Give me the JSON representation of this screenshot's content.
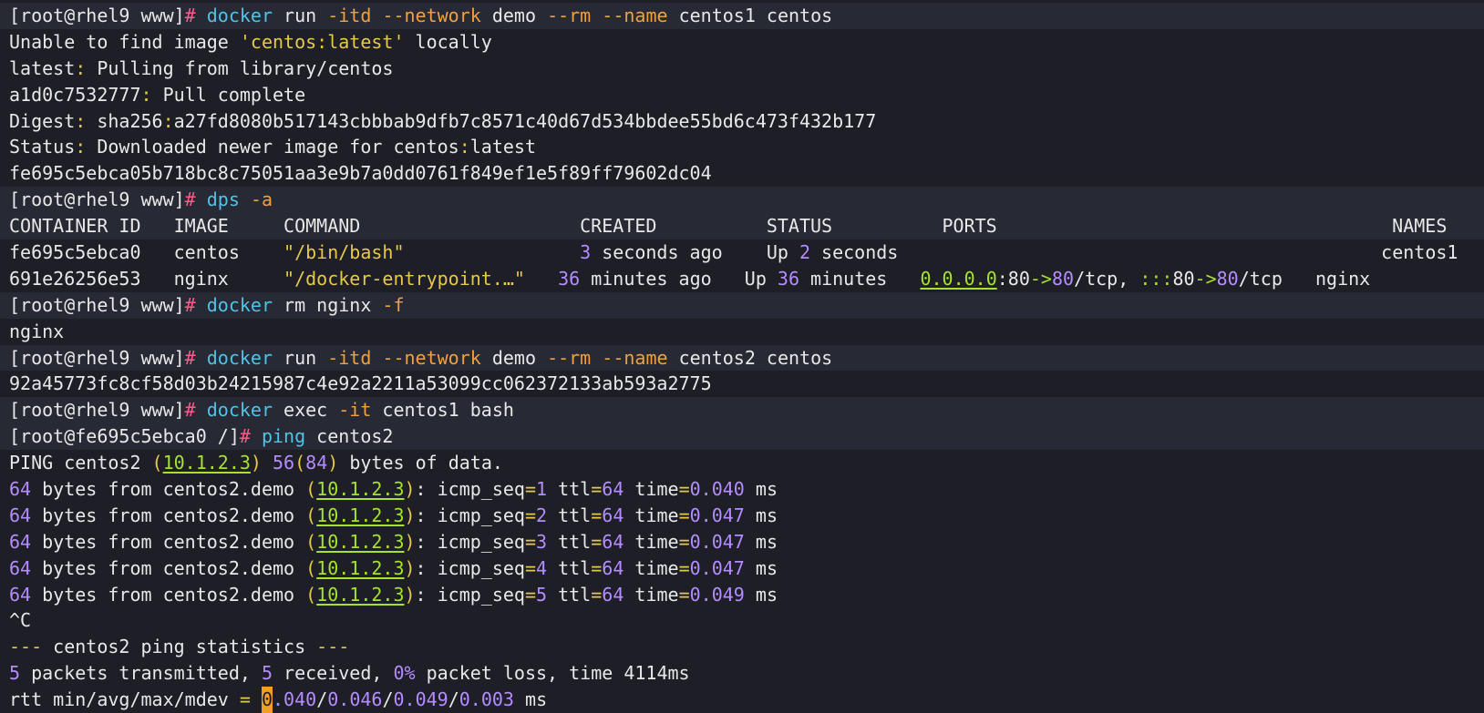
{
  "colors": {
    "background": "#1e1f26",
    "command_row": "#272a34",
    "default": "#e8e8e8",
    "prompt_hash": "#ff5c8a",
    "command": "#4fc3e8",
    "flag": "#f0a040",
    "string": "#e6c84a",
    "number": "#b48cff",
    "ip": "#a6e22e",
    "cursor": "#f0a020"
  },
  "lines": [
    {
      "hl": true,
      "segs": [
        [
          "[root@rhel9 www]",
          "fg"
        ],
        [
          "# ",
          "pink"
        ],
        [
          "docker",
          "cyan"
        ],
        [
          " run ",
          "fg"
        ],
        [
          "-itd",
          "orange"
        ],
        [
          " ",
          "fg"
        ],
        [
          "--network",
          "orange"
        ],
        [
          " demo ",
          "fg"
        ],
        [
          "--rm",
          "orange"
        ],
        [
          " ",
          "fg"
        ],
        [
          "--name",
          "orange"
        ],
        [
          " centos1 centos",
          "fg"
        ]
      ]
    },
    {
      "hl": false,
      "segs": [
        [
          "Unable to find image ",
          "fg"
        ],
        [
          "'centos:latest'",
          "yellow"
        ],
        [
          " locally",
          "fg"
        ]
      ]
    },
    {
      "hl": false,
      "segs": [
        [
          "latest",
          "fg"
        ],
        [
          ":",
          "yellow"
        ],
        [
          " Pulling from library/centos",
          "fg"
        ]
      ]
    },
    {
      "hl": false,
      "segs": [
        [
          "a1d0c7532777",
          "fg"
        ],
        [
          ":",
          "yellow"
        ],
        [
          " Pull complete",
          "fg"
        ]
      ]
    },
    {
      "hl": false,
      "segs": [
        [
          "Digest",
          "fg"
        ],
        [
          ":",
          "yellow"
        ],
        [
          " sha256",
          "fg"
        ],
        [
          ":",
          "yellow"
        ],
        [
          "a27fd8080b517143cbbbab9dfb7c8571c40d67d534bbdee55bd6c473f432b177",
          "fg"
        ]
      ]
    },
    {
      "hl": false,
      "segs": [
        [
          "Status",
          "fg"
        ],
        [
          ":",
          "yellow"
        ],
        [
          " Downloaded newer image for centos",
          "fg"
        ],
        [
          ":",
          "yellow"
        ],
        [
          "latest",
          "fg"
        ]
      ]
    },
    {
      "hl": false,
      "segs": [
        [
          "fe695c5ebca05b718bc8c75051aa3e9b7a0dd0761f849ef1e5f89ff79602dc04",
          "fg"
        ]
      ]
    },
    {
      "hl": true,
      "segs": [
        [
          "[root@rhel9 www]",
          "fg"
        ],
        [
          "# ",
          "pink"
        ],
        [
          "dps",
          "cyan"
        ],
        [
          " ",
          "fg"
        ],
        [
          "-a",
          "orange"
        ]
      ]
    },
    {
      "hl": true,
      "segs": [
        [
          "CONTAINER ID   IMAGE     COMMAND                    CREATED          STATUS          PORTS                                    NAMES",
          "fg"
        ]
      ]
    },
    {
      "hl": false,
      "segs": [
        [
          "fe695c5ebca0   centos    ",
          "fg"
        ],
        [
          "\"/bin/bash\"",
          "yellow"
        ],
        [
          "                ",
          "fg"
        ],
        [
          "3",
          "purple"
        ],
        [
          " seconds ago    Up ",
          "fg"
        ],
        [
          "2",
          "purple"
        ],
        [
          " seconds                                            centos1",
          "fg"
        ]
      ]
    },
    {
      "hl": false,
      "segs": [
        [
          "691e26256e53   nginx     ",
          "fg"
        ],
        [
          "\"/docker-entrypoint.…\"",
          "yellow"
        ],
        [
          "   ",
          "fg"
        ],
        [
          "36",
          "purple"
        ],
        [
          " minutes ago   Up ",
          "fg"
        ],
        [
          "36",
          "purple"
        ],
        [
          " minutes   ",
          "fg"
        ],
        [
          "0.0.0.0",
          "green",
          "u"
        ],
        [
          ":80",
          "fg"
        ],
        [
          "->",
          "green"
        ],
        [
          "80",
          "purple"
        ],
        [
          "/tcp, ",
          "fg"
        ],
        [
          ":::",
          "green"
        ],
        [
          "80",
          "fg"
        ],
        [
          "->",
          "green"
        ],
        [
          "80",
          "purple"
        ],
        [
          "/tcp   nginx",
          "fg"
        ]
      ]
    },
    {
      "hl": true,
      "segs": [
        [
          "[root@rhel9 www]",
          "fg"
        ],
        [
          "# ",
          "pink"
        ],
        [
          "docker",
          "cyan"
        ],
        [
          " rm nginx ",
          "fg"
        ],
        [
          "-f",
          "orange"
        ]
      ]
    },
    {
      "hl": false,
      "segs": [
        [
          "nginx",
          "fg"
        ]
      ]
    },
    {
      "hl": true,
      "segs": [
        [
          "[root@rhel9 www]",
          "fg"
        ],
        [
          "# ",
          "pink"
        ],
        [
          "docker",
          "cyan"
        ],
        [
          " run ",
          "fg"
        ],
        [
          "-itd",
          "orange"
        ],
        [
          " ",
          "fg"
        ],
        [
          "--network",
          "orange"
        ],
        [
          " demo ",
          "fg"
        ],
        [
          "--rm",
          "orange"
        ],
        [
          " ",
          "fg"
        ],
        [
          "--name",
          "orange"
        ],
        [
          " centos2 centos",
          "fg"
        ]
      ]
    },
    {
      "hl": false,
      "segs": [
        [
          "92a45773fc8cf58d03b24215987c4e92a2211a53099cc062372133ab593a2775",
          "fg"
        ]
      ]
    },
    {
      "hl": true,
      "segs": [
        [
          "[root@rhel9 www]",
          "fg"
        ],
        [
          "# ",
          "pink"
        ],
        [
          "docker",
          "cyan"
        ],
        [
          " exec ",
          "fg"
        ],
        [
          "-it",
          "orange"
        ],
        [
          " centos1 bash",
          "fg"
        ]
      ]
    },
    {
      "hl": true,
      "segs": [
        [
          "[root@fe695c5ebca0 /]",
          "fg"
        ],
        [
          "# ",
          "pink"
        ],
        [
          "ping",
          "cyan"
        ],
        [
          " centos2",
          "fg"
        ]
      ]
    },
    {
      "hl": false,
      "segs": [
        [
          "PING centos2 ",
          "fg"
        ],
        [
          "(",
          "yellow"
        ],
        [
          "10.1.2.3",
          "green",
          "u"
        ],
        [
          ")",
          "yellow"
        ],
        [
          " ",
          "fg"
        ],
        [
          "56",
          "purple"
        ],
        [
          "(",
          "yellow"
        ],
        [
          "84",
          "purple"
        ],
        [
          ")",
          "yellow"
        ],
        [
          " bytes of data.",
          "fg"
        ]
      ]
    },
    {
      "hl": false,
      "segs": [
        [
          "64",
          "purple"
        ],
        [
          " bytes from centos2.demo ",
          "fg"
        ],
        [
          "(",
          "yellow"
        ],
        [
          "10.1.2.3",
          "green",
          "u"
        ],
        [
          ")",
          "yellow"
        ],
        [
          ": icmp_seq",
          "fg"
        ],
        [
          "=",
          "yellow"
        ],
        [
          "1",
          "purple"
        ],
        [
          " ttl",
          "fg"
        ],
        [
          "=",
          "yellow"
        ],
        [
          "64",
          "purple"
        ],
        [
          " time",
          "fg"
        ],
        [
          "=",
          "yellow"
        ],
        [
          "0.040",
          "purple"
        ],
        [
          " ms",
          "fg"
        ]
      ]
    },
    {
      "hl": false,
      "segs": [
        [
          "64",
          "purple"
        ],
        [
          " bytes from centos2.demo ",
          "fg"
        ],
        [
          "(",
          "yellow"
        ],
        [
          "10.1.2.3",
          "green",
          "u"
        ],
        [
          ")",
          "yellow"
        ],
        [
          ": icmp_seq",
          "fg"
        ],
        [
          "=",
          "yellow"
        ],
        [
          "2",
          "purple"
        ],
        [
          " ttl",
          "fg"
        ],
        [
          "=",
          "yellow"
        ],
        [
          "64",
          "purple"
        ],
        [
          " time",
          "fg"
        ],
        [
          "=",
          "yellow"
        ],
        [
          "0.047",
          "purple"
        ],
        [
          " ms",
          "fg"
        ]
      ]
    },
    {
      "hl": false,
      "segs": [
        [
          "64",
          "purple"
        ],
        [
          " bytes from centos2.demo ",
          "fg"
        ],
        [
          "(",
          "yellow"
        ],
        [
          "10.1.2.3",
          "green",
          "u"
        ],
        [
          ")",
          "yellow"
        ],
        [
          ": icmp_seq",
          "fg"
        ],
        [
          "=",
          "yellow"
        ],
        [
          "3",
          "purple"
        ],
        [
          " ttl",
          "fg"
        ],
        [
          "=",
          "yellow"
        ],
        [
          "64",
          "purple"
        ],
        [
          " time",
          "fg"
        ],
        [
          "=",
          "yellow"
        ],
        [
          "0.047",
          "purple"
        ],
        [
          " ms",
          "fg"
        ]
      ]
    },
    {
      "hl": false,
      "segs": [
        [
          "64",
          "purple"
        ],
        [
          " bytes from centos2.demo ",
          "fg"
        ],
        [
          "(",
          "yellow"
        ],
        [
          "10.1.2.3",
          "green",
          "u"
        ],
        [
          ")",
          "yellow"
        ],
        [
          ": icmp_seq",
          "fg"
        ],
        [
          "=",
          "yellow"
        ],
        [
          "4",
          "purple"
        ],
        [
          " ttl",
          "fg"
        ],
        [
          "=",
          "yellow"
        ],
        [
          "64",
          "purple"
        ],
        [
          " time",
          "fg"
        ],
        [
          "=",
          "yellow"
        ],
        [
          "0.047",
          "purple"
        ],
        [
          " ms",
          "fg"
        ]
      ]
    },
    {
      "hl": false,
      "segs": [
        [
          "64",
          "purple"
        ],
        [
          " bytes from centos2.demo ",
          "fg"
        ],
        [
          "(",
          "yellow"
        ],
        [
          "10.1.2.3",
          "green",
          "u"
        ],
        [
          ")",
          "yellow"
        ],
        [
          ": icmp_seq",
          "fg"
        ],
        [
          "=",
          "yellow"
        ],
        [
          "5",
          "purple"
        ],
        [
          " ttl",
          "fg"
        ],
        [
          "=",
          "yellow"
        ],
        [
          "64",
          "purple"
        ],
        [
          " time",
          "fg"
        ],
        [
          "=",
          "yellow"
        ],
        [
          "0.049",
          "purple"
        ],
        [
          " ms",
          "fg"
        ]
      ]
    },
    {
      "hl": false,
      "segs": [
        [
          "^C",
          "fg"
        ]
      ]
    },
    {
      "hl": false,
      "segs": [
        [
          "---",
          "yellow"
        ],
        [
          " centos2 ping statistics ",
          "fg"
        ],
        [
          "---",
          "yellow"
        ]
      ]
    },
    {
      "hl": false,
      "segs": [
        [
          "5",
          "purple"
        ],
        [
          " packets transmitted, ",
          "fg"
        ],
        [
          "5",
          "purple"
        ],
        [
          " received, ",
          "fg"
        ],
        [
          "0%",
          "purple"
        ],
        [
          " packet loss, time 4114ms",
          "fg"
        ]
      ]
    },
    {
      "hl": false,
      "segs": [
        [
          "rtt min/avg/max/mdev ",
          "fg"
        ],
        [
          "=",
          "yellow"
        ],
        [
          " ",
          "fg"
        ],
        [
          "0",
          "cursor"
        ],
        [
          ".040",
          "purple"
        ],
        [
          "/",
          "fg"
        ],
        [
          "0.046",
          "purple"
        ],
        [
          "/",
          "fg"
        ],
        [
          "0.049",
          "purple"
        ],
        [
          "/",
          "fg"
        ],
        [
          "0.003",
          "purple"
        ],
        [
          " ms",
          "fg"
        ]
      ]
    }
  ]
}
